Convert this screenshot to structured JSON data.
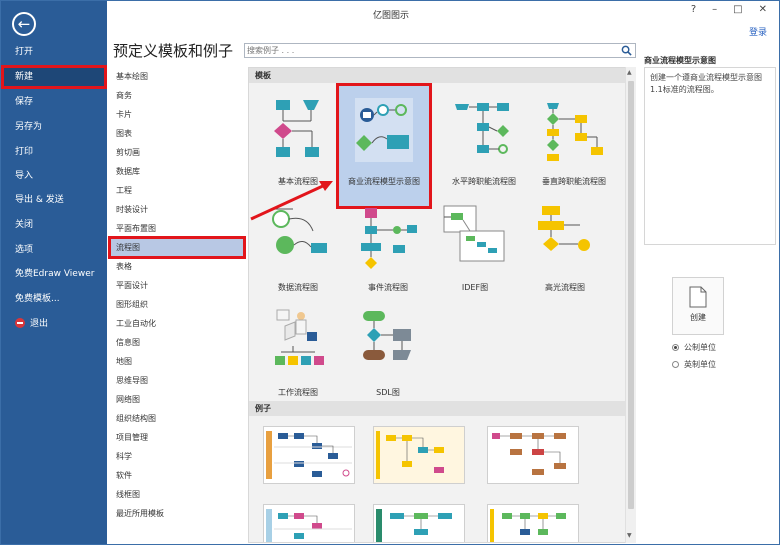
{
  "app_title": "亿图图示",
  "window_controls": {
    "help": "?",
    "minimize": "–",
    "restore": "□",
    "close": "✕"
  },
  "login": "登录",
  "sidebar": {
    "items": [
      {
        "label": "打开",
        "icon": ""
      },
      {
        "label": "新建",
        "icon": ""
      },
      {
        "label": "保存",
        "icon": ""
      },
      {
        "label": "另存为",
        "icon": ""
      },
      {
        "label": "打印",
        "icon": ""
      },
      {
        "label": "导入",
        "icon": ""
      },
      {
        "label": "导出 & 发送",
        "icon": ""
      },
      {
        "label": "关闭",
        "icon": ""
      },
      {
        "label": "选项",
        "icon": ""
      },
      {
        "label": "免费Edraw Viewer",
        "icon": ""
      },
      {
        "label": "免费模板...",
        "icon": ""
      },
      {
        "label": "退出",
        "icon": "exit-icon"
      }
    ],
    "active_index": 1,
    "back_icon": "back-arrow-icon"
  },
  "header": {
    "title": "预定义模板和例子"
  },
  "search": {
    "placeholder": "搜索例子 . . .",
    "icon": "search-icon"
  },
  "categories": [
    "基本绘图",
    "商务",
    "卡片",
    "图表",
    "剪切画",
    "数据库",
    "工程",
    "时装设计",
    "平面布置图",
    "流程图",
    "表格",
    "平面设计",
    "图形组织",
    "工业自动化",
    "信息图",
    "地图",
    "思维导图",
    "网络图",
    "组织结构图",
    "项目管理",
    "科学",
    "软件",
    "线框图",
    "最近所用模板"
  ],
  "selected_category": 9,
  "sections": {
    "templates": "模板",
    "examples": "例子"
  },
  "templates": [
    {
      "label": "基本流程图"
    },
    {
      "label": "商业流程模型示意图"
    },
    {
      "label": "水平跨职能流程图"
    },
    {
      "label": "垂直跨职能流程图"
    },
    {
      "label": "数据流程图"
    },
    {
      "label": "事件流程图"
    },
    {
      "label": "IDEF图"
    },
    {
      "label": "高光流程图"
    },
    {
      "label": "工作流程图"
    },
    {
      "label": "SDL图"
    }
  ],
  "selected_template": 1,
  "right_pane": {
    "title": "商业流程模型示意图",
    "description": "创建一个遵商业流程模型示意图1.1标准的流程图。",
    "create_label": "创建",
    "units": [
      {
        "label": "公制单位",
        "checked": true
      },
      {
        "label": "英制单位",
        "checked": false
      }
    ]
  },
  "colors": {
    "sidebar": "#2a5c97",
    "highlight": "#e2151b",
    "teal": "#2ea0b5",
    "pink": "#d04a8c",
    "green": "#5cb85c",
    "yellow": "#f5c400"
  }
}
